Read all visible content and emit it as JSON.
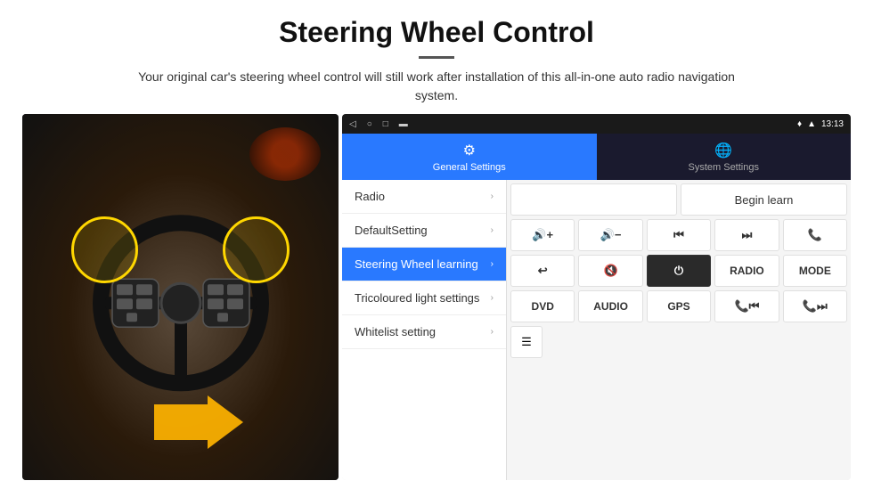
{
  "header": {
    "title": "Steering Wheel Control",
    "subtitle": "Your original car's steering wheel control will still work after installation of this all-in-one auto radio navigation system."
  },
  "statusBar": {
    "navBack": "◁",
    "navHome": "○",
    "navRecent": "□",
    "navCast": "▬",
    "gpsIcon": "♦",
    "signalIcon": "▲",
    "time": "13:13"
  },
  "tabs": [
    {
      "label": "General Settings",
      "icon": "⚙",
      "active": true
    },
    {
      "label": "System Settings",
      "icon": "🌐",
      "active": false
    }
  ],
  "menu": {
    "items": [
      {
        "label": "Radio",
        "active": false
      },
      {
        "label": "DefaultSetting",
        "active": false
      },
      {
        "label": "Steering Wheel learning",
        "active": true
      },
      {
        "label": "Tricoloured light settings",
        "active": false
      },
      {
        "label": "Whitelist setting",
        "active": false
      }
    ]
  },
  "controls": {
    "beginLearn": "Begin learn",
    "buttons": {
      "row1": [
        "🔊+",
        "🔊−",
        "⏮",
        "⏭",
        "📞"
      ],
      "row2": [
        "↩",
        "🔊✕",
        "⏻",
        "RADIO",
        "MODE"
      ],
      "row3": [
        "DVD",
        "AUDIO",
        "GPS",
        "📞⏮",
        "📞⏭"
      ],
      "row4": [
        "≡"
      ]
    }
  }
}
